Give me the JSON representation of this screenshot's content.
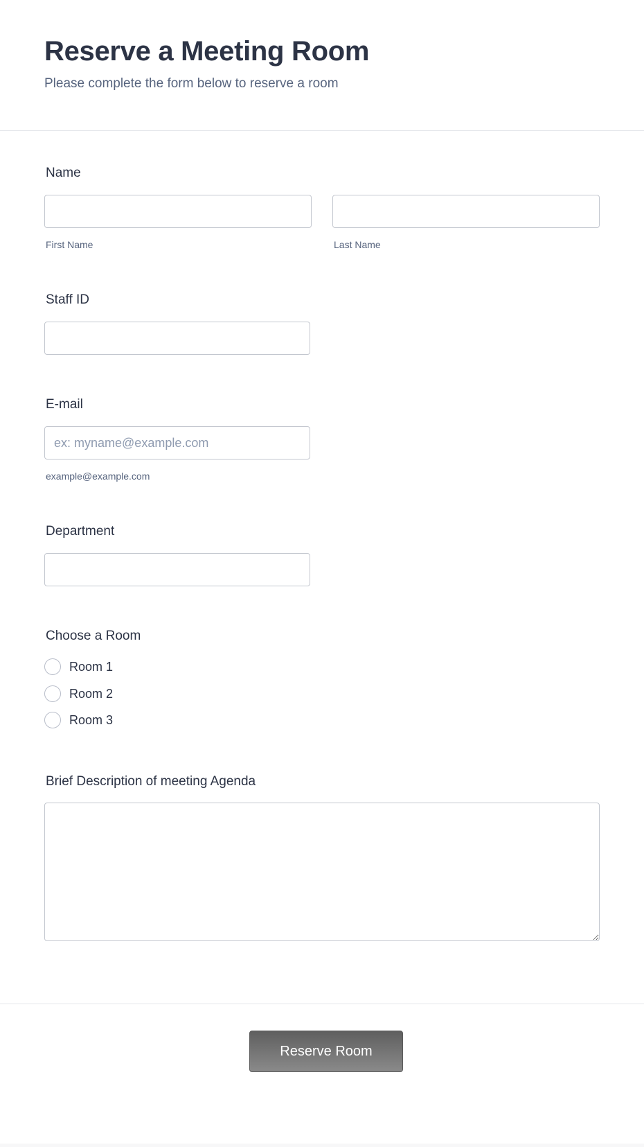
{
  "header": {
    "title": "Reserve a Meeting Room",
    "subtitle": "Please complete the form below to reserve a room"
  },
  "form": {
    "name": {
      "label": "Name",
      "first_name": {
        "value": "",
        "sublabel": "First Name"
      },
      "last_name": {
        "value": "",
        "sublabel": "Last Name"
      }
    },
    "staff_id": {
      "label": "Staff ID",
      "value": ""
    },
    "email": {
      "label": "E-mail",
      "value": "",
      "placeholder": "ex: myname@example.com",
      "sublabel": "example@example.com"
    },
    "department": {
      "label": "Department",
      "value": ""
    },
    "room": {
      "label": "Choose a Room",
      "options": [
        {
          "label": "Room 1",
          "checked": false
        },
        {
          "label": "Room 2",
          "checked": false
        },
        {
          "label": "Room 3",
          "checked": false
        }
      ]
    },
    "agenda": {
      "label": "Brief Description of meeting Agenda",
      "value": ""
    }
  },
  "submit": {
    "label": "Reserve Room"
  },
  "colors": {
    "text_primary": "#2c3345",
    "text_secondary": "#57647e",
    "input_border": "#c3c7cf",
    "button_gradient_top": "#5f5f5f",
    "button_gradient_bottom": "#8a8a8a"
  }
}
